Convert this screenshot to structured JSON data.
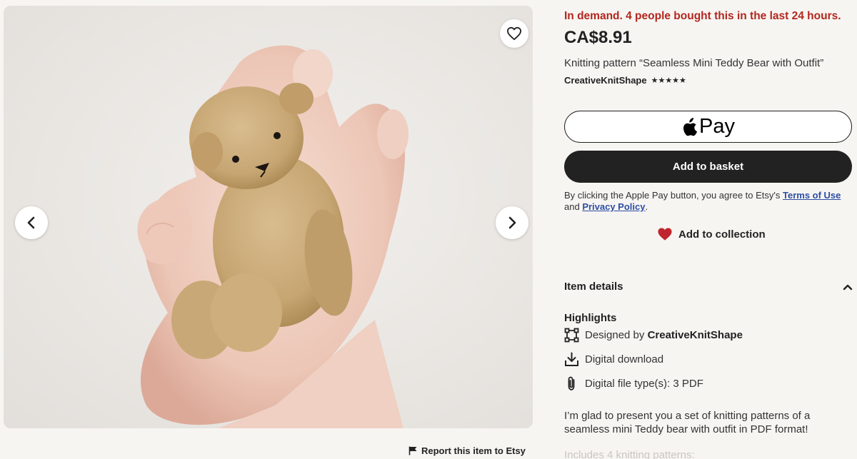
{
  "gallery": {
    "prev_label": "Previous image",
    "next_label": "Next image",
    "favorite_label": "Add to favourites"
  },
  "report": {
    "label": "Report this item to Etsy"
  },
  "listing": {
    "demand_text": "In demand. 4 people bought this in the last 24 hours.",
    "price": "CA$8.91",
    "title": "Knitting pattern “Seamless Mini Teddy Bear with Outfit”",
    "shop_name": "CreativeKnitShape",
    "rating_stars": "★★★★★",
    "rating_value": 5
  },
  "buttons": {
    "apple_pay_label": "Pay",
    "basket_label": "Add to basket",
    "collection_label": "Add to collection"
  },
  "legal": {
    "prefix": "By clicking the Apple Pay button, you agree to Etsy's ",
    "terms_link": "Terms of Use",
    "and_text": "and ",
    "privacy_link": "Privacy Policy",
    "suffix": "."
  },
  "details": {
    "header": "Item details",
    "highlights_title": "Highlights",
    "designed_prefix": "Designed by ",
    "designed_by": "CreativeKnitShape",
    "download": "Digital download",
    "file_types": "Digital file type(s): 3 PDF",
    "description": "I’m glad to present you a set of knitting patterns of a seamless mini Teddy bear with outfit in PDF format!",
    "description_more": "Includes 4 knitting patterns:"
  },
  "colors": {
    "demand": "#b3261e",
    "primary_button": "#222222",
    "link": "#2d4ea3",
    "heart": "#c0262d",
    "background": "#f7f5f2"
  },
  "icons": [
    "chevron-left-icon",
    "chevron-right-icon",
    "heart-outline-icon",
    "flag-icon",
    "apple-logo-icon",
    "heart-filled-icon",
    "chevron-up-icon",
    "designer-icon",
    "download-icon",
    "paperclip-icon"
  ]
}
